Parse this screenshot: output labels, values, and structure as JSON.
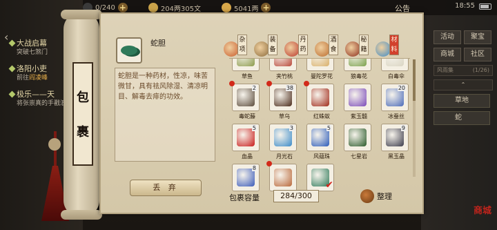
{
  "status_bar": {
    "resource1_value": "0/240",
    "resource2_value": "204两305文",
    "resource3_value": "5041两",
    "announcement": "公告",
    "time": "18:55"
  },
  "quests": [
    {
      "title": "大战启幕",
      "desc_prefix": "",
      "desc_highlight": "",
      "desc_suffix": "突破七煞门"
    },
    {
      "title": "洛阳小吏",
      "desc_prefix": "前往",
      "desc_highlight": "阎凌峰",
      "desc_suffix": ""
    },
    {
      "title": "极乐——天",
      "desc_prefix": "",
      "desc_highlight": "",
      "desc_suffix": "将张崇真的手戳浪"
    }
  ],
  "right_menu": {
    "row1": [
      "活动",
      "聚宝"
    ],
    "row2": [
      "商城",
      "社区"
    ],
    "bar_label": "风雨集",
    "bar_value": "(1/26)",
    "arrow_label": "⌃",
    "items": [
      "草地",
      "蛇"
    ],
    "corner_stamp": "商城"
  },
  "bag": {
    "title_chars": [
      "包",
      "裹"
    ],
    "selected_name": "蛇胆",
    "description": "蛇胆是一种药材，性凉，味苦微甘，具有祛风除湿、清凉明目、解毒去痱的功效。",
    "drop_label": "丢 弃",
    "capacity_label": "包裹容量",
    "capacity_value": "284/300",
    "sort_label": "整理"
  },
  "tabs": [
    {
      "label": "杂项",
      "color": "#c85a2a"
    },
    {
      "label": "装备",
      "color": "#8a6a3a"
    },
    {
      "label": "丹药",
      "color": "#b9342a"
    },
    {
      "label": "酒食",
      "color": "#b9682a"
    },
    {
      "label": "秘籍",
      "color": "#8a2a1a"
    },
    {
      "label": "材料",
      "color": "#3a8ac8"
    }
  ],
  "items": [
    {
      "name": "草鱼",
      "count": "",
      "color": "#8b9a4a",
      "dot": false,
      "check": false
    },
    {
      "name": "夹竹桃",
      "count": "",
      "color": "#b9483a",
      "dot": false,
      "check": false
    },
    {
      "name": "曼陀罗花",
      "count": "",
      "color": "#d9b06a",
      "dot": false,
      "check": false
    },
    {
      "name": "狼毒花",
      "count": "",
      "color": "#7aa04a",
      "dot": false,
      "check": false
    },
    {
      "name": "白毒伞",
      "count": "",
      "color": "#d9d4c2",
      "dot": false,
      "check": false
    },
    {
      "name": "毒蛇藤",
      "count": "2",
      "color": "#5a4a3a",
      "dot": true,
      "check": false
    },
    {
      "name": "草乌",
      "count": "38",
      "color": "#4a2a1a",
      "dot": true,
      "check": false
    },
    {
      "name": "红蛛蚁",
      "count": "",
      "color": "#a02a1a",
      "dot": true,
      "check": false
    },
    {
      "name": "紫玉髓",
      "count": "",
      "color": "#7a4ab9",
      "dot": false,
      "check": false
    },
    {
      "name": "冰蚕丝",
      "count": "20",
      "color": "#4a6ab9",
      "dot": false,
      "check": false
    },
    {
      "name": "血晶",
      "count": "5",
      "color": "#c81a1a",
      "dot": false,
      "check": false
    },
    {
      "name": "月光石",
      "count": "3",
      "color": "#3a8ac8",
      "dot": false,
      "check": false
    },
    {
      "name": "风蕴珠",
      "count": "5",
      "color": "#2a5ab9",
      "dot": false,
      "check": false
    },
    {
      "name": "七星岩",
      "count": "",
      "color": "#2a5a2a",
      "dot": false,
      "check": false
    },
    {
      "name": "黑玉晶",
      "count": "9",
      "color": "#3a3a4a",
      "dot": false,
      "check": false
    },
    {
      "name": "青金石",
      "count": "8",
      "color": "#3a5ab9",
      "dot": false,
      "check": false
    },
    {
      "name": "蛇肉",
      "count": "",
      "color": "#b9683a",
      "dot": true,
      "check": false
    },
    {
      "name": "蛇胆",
      "count": "",
      "color": "#2f7a5a",
      "dot": false,
      "check": true
    }
  ]
}
